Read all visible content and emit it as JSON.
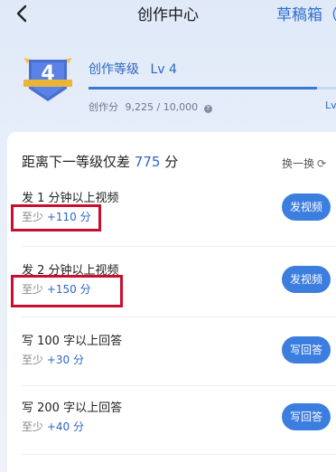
{
  "header": {
    "title": "创作中心",
    "drafts_label": "草稿箱（"
  },
  "level": {
    "badge_number": "4",
    "name": "创作等级",
    "level_label": "Lv 4",
    "score_label": "创作分",
    "score_value": "9,225 / 10,000",
    "progress_fraction": 0.9225,
    "next_level_label": "Lv"
  },
  "gap": {
    "prefix": "距离下一等级仅差",
    "value": "775",
    "suffix": "分",
    "refresh_label": "换一换"
  },
  "tasks": [
    {
      "title": "发 1 分钟以上视频",
      "reward_prefix": "至少",
      "reward_points": "+110 分",
      "button": "发视频"
    },
    {
      "title": "发 2 分钟以上视频",
      "reward_prefix": "至少",
      "reward_points": "+150 分",
      "button": "发视频"
    },
    {
      "title": "写 100 字以上回答",
      "reward_prefix": "至少",
      "reward_points": "+30 分",
      "button": "写回答"
    },
    {
      "title": "写 200 字以上回答",
      "reward_prefix": "至少",
      "reward_points": "+40 分",
      "button": "写回答"
    }
  ],
  "colors": {
    "accent": "#3c7ee0",
    "highlight": "#c8102e"
  }
}
